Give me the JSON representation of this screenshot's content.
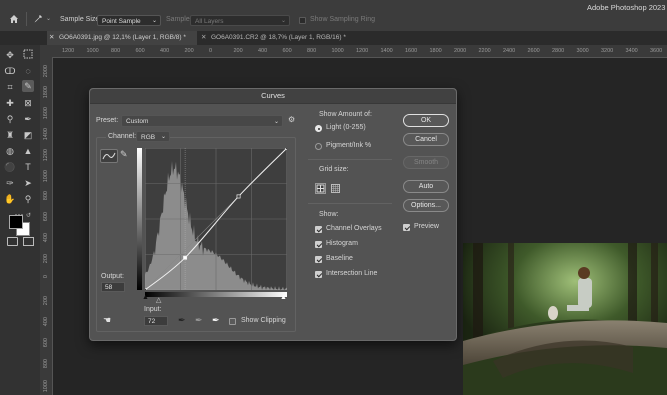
{
  "app": {
    "title": "Adobe Photoshop 2023"
  },
  "options_bar": {
    "sample_size_label": "Sample Size:",
    "sample_size_value": "Point Sample",
    "sample_label": "Sample:",
    "sample_value": "All Layers",
    "show_sampling_ring_label": "Show Sampling Ring"
  },
  "tabs": [
    {
      "label": "GO6A0391.jpg @ 12,1% (Layer 1, RGB/8) *",
      "active": true
    },
    {
      "label": "GO6A0391.CR2 @ 18,7% (Layer 1, RGB/16) *",
      "active": false
    }
  ],
  "ruler": {
    "h": [
      "1200",
      "1000",
      "800",
      "600",
      "400",
      "200",
      "0",
      "200",
      "400",
      "600",
      "800",
      "1000",
      "1200",
      "1400",
      "1600",
      "1800",
      "2000",
      "2200",
      "2400",
      "2600",
      "2800",
      "3000",
      "3200",
      "3400",
      "3600"
    ],
    "v": [
      "2000",
      "1800",
      "1600",
      "1400",
      "1200",
      "1000",
      "800",
      "600",
      "400",
      "200",
      "0",
      "200",
      "400",
      "600",
      "800",
      "1000"
    ]
  },
  "curves": {
    "title": "Curves",
    "preset_label": "Preset:",
    "preset_value": "Custom",
    "channel_label": "Channel:",
    "channel_value": "RGB",
    "output_label": "Output:",
    "output_value": "58",
    "input_label": "Input:",
    "input_value": "72",
    "show_clipping_label": "Show Clipping",
    "show_amount_label": "Show Amount of:",
    "light_label": "Light  (0-255)",
    "pigment_label": "Pigment/Ink %",
    "grid_size_label": "Grid size:",
    "show_label": "Show:",
    "channel_overlays_label": "Channel Overlays",
    "histogram_label": "Histogram",
    "baseline_label": "Baseline",
    "intersection_line_label": "Intersection Line",
    "ok_label": "OK",
    "cancel_label": "Cancel",
    "smooth_label": "Smooth",
    "auto_label": "Auto",
    "options_label": "Options...",
    "preview_label": "Preview",
    "points": [
      [
        0,
        0
      ],
      [
        72,
        58
      ],
      [
        168,
        168
      ],
      [
        255,
        255
      ]
    ]
  },
  "colors": {
    "accent": "#e6e6e6",
    "dialog_bg": "#535353",
    "workspace": "#252525"
  }
}
